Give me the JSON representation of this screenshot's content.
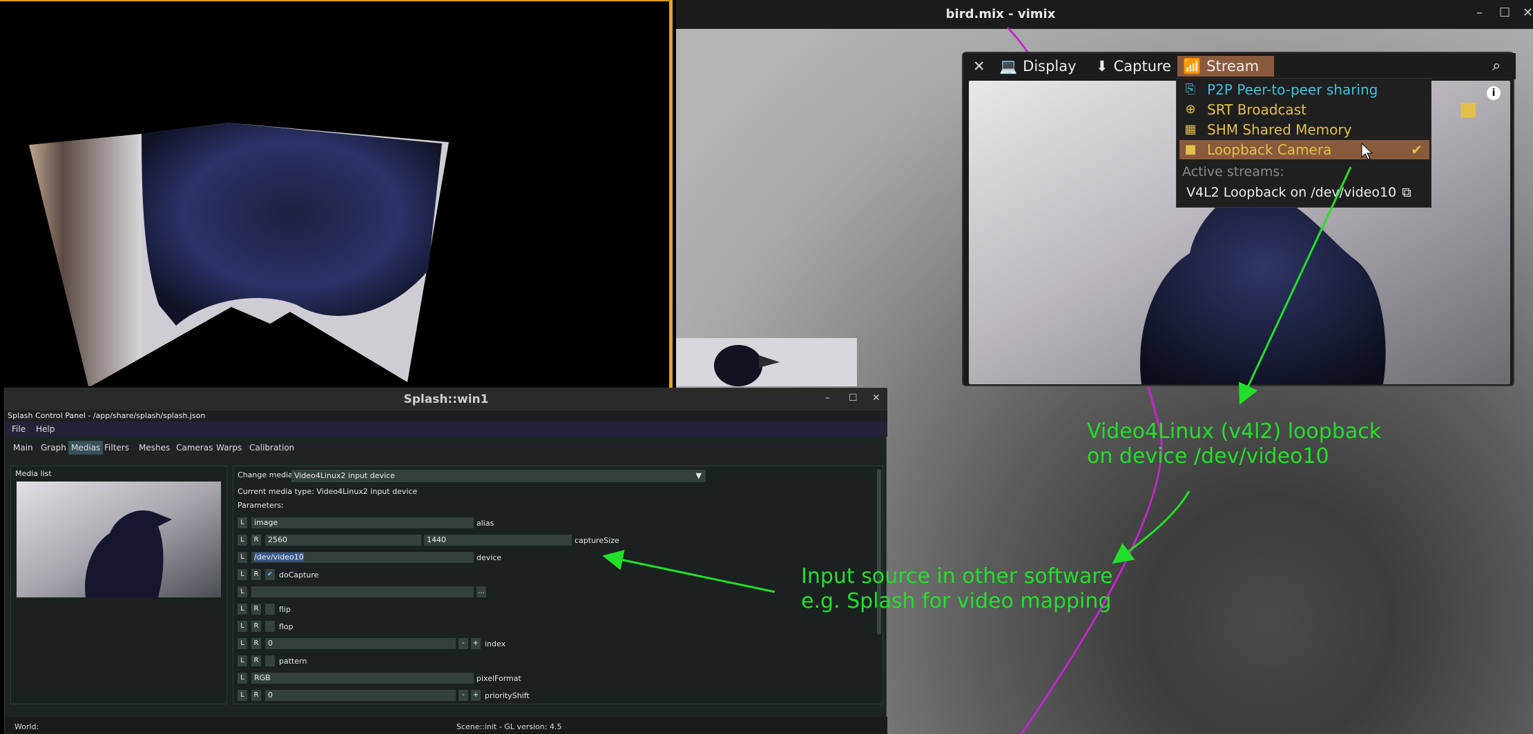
{
  "vimix": {
    "title": "bird.mix - vimix",
    "tabs": [
      {
        "label": "Display",
        "icon": "laptop-icon"
      },
      {
        "label": "Capture",
        "icon": "download-icon"
      },
      {
        "label": "Stream",
        "icon": "wifi-icon"
      }
    ],
    "stream_menu": {
      "items": [
        {
          "label": "P2P Peer-to-peer sharing",
          "icon": "share-icon",
          "color": "#3cc3e0"
        },
        {
          "label": "SRT Broadcast",
          "icon": "globe-icon",
          "color": "#e2c04a"
        },
        {
          "label": "SHM Shared Memory",
          "icon": "memory-icon",
          "color": "#e2c04a"
        },
        {
          "label": "Loopback Camera",
          "icon": "video-camera-icon",
          "color": "#e2c04a",
          "checked": true
        }
      ],
      "active_streams_label": "Active streams:",
      "active_stream": "V4L2 Loopback on /dev/video10"
    }
  },
  "splash": {
    "window_title": "Splash::win1",
    "subtitle": "Splash Control Panel - /app/share/splash/splash.json",
    "menu": [
      "File",
      "Help"
    ],
    "tabs": [
      "Main",
      "Graph",
      "Medias",
      "Filters",
      "Meshes",
      "Cameras",
      "Warps",
      "Calibration"
    ],
    "active_tab": "Medias",
    "media_list_label": "Media list",
    "change_media_label": "Change media type:",
    "media_type": "Video4Linux2 input device",
    "current_media": "Current media type: Video4Linux2 input device",
    "parameters_label": "Parameters:",
    "params": {
      "alias": {
        "value": "image",
        "label": "alias"
      },
      "capture_w": "2560",
      "capture_h": "1440",
      "capture_label": "captureSize",
      "device_value": "/dev/video10",
      "device_label": "device",
      "docapture_label": "doCapture",
      "browse_label": "...",
      "flip_label": "flip",
      "flop_label": "flop",
      "index_value": "0",
      "index_label": "index",
      "pattern_label": "pattern",
      "pixel_value": "RGB",
      "pixel_label": "pixelFormat",
      "shift_value": "0",
      "shift_label": "priorityShift"
    },
    "status_left": "World:",
    "status_right": "Scene::init - GL version: 4.5"
  },
  "annotations": {
    "v4l2_line1": "Video4Linux (v4l2) loopback",
    "v4l2_line2": "on device /dev/video10",
    "input_line1": "Input source in other software",
    "input_line2": "e.g. Splash for video mapping"
  },
  "colors": {
    "accent": "#e8a51e",
    "annotation": "#22e02a",
    "stream_tab": "#8a5a3c"
  }
}
